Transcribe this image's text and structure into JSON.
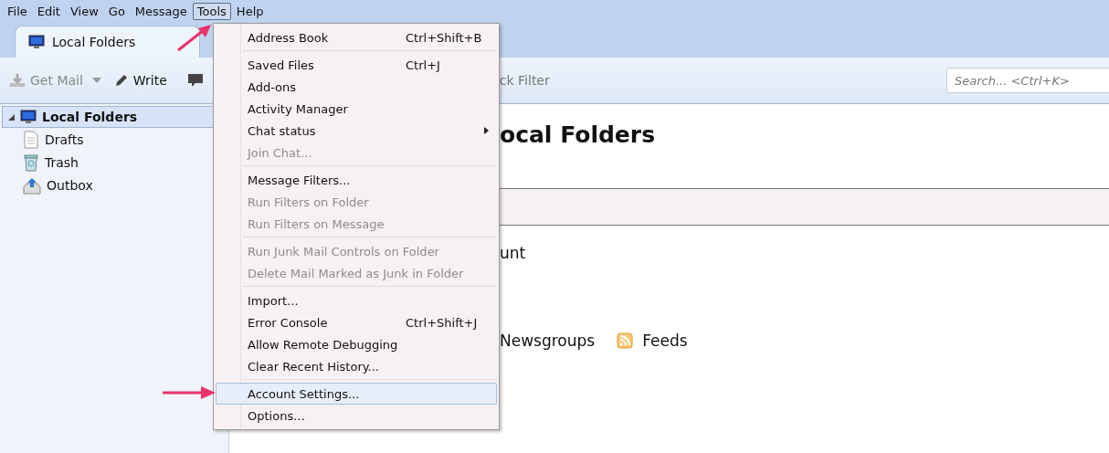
{
  "menubar": [
    {
      "label": "File",
      "selected": false
    },
    {
      "label": "Edit",
      "selected": false
    },
    {
      "label": "View",
      "selected": false
    },
    {
      "label": "Go",
      "selected": false
    },
    {
      "label": "Message",
      "selected": false
    },
    {
      "label": "Tools",
      "selected": true
    },
    {
      "label": "Help",
      "selected": false
    }
  ],
  "tabs": [
    {
      "label": "Local Folders",
      "selected": true
    }
  ],
  "toolbar": {
    "get_mail": {
      "label": "Get Mail",
      "disabled": true
    },
    "write": {
      "label": "Write"
    },
    "quick_filter_visible": "ck Filter",
    "search": {
      "placeholder": "Search... <Ctrl+K>"
    }
  },
  "sidebar": {
    "items": [
      {
        "label": "Local Folders",
        "kind": "account",
        "selected": true,
        "expanded": true,
        "children": [
          {
            "label": "Drafts",
            "kind": "drafts",
            "selected": false
          },
          {
            "label": "Trash",
            "kind": "trash",
            "selected": false
          },
          {
            "label": "Outbox",
            "kind": "outbox",
            "selected": false
          }
        ]
      }
    ]
  },
  "content": {
    "heading_visible": "ocal Folders",
    "account_text_visible": "unt",
    "newsgroups_visible": "Newsgroups",
    "feeds": "Feeds"
  },
  "tools_menu": {
    "groups": [
      [
        {
          "label": "Address Book",
          "shortcut": "Ctrl+Shift+B",
          "disabled": false,
          "selected": false,
          "submenu": false
        }
      ],
      [
        {
          "label": "Saved Files",
          "shortcut": "Ctrl+J",
          "disabled": false,
          "selected": false,
          "submenu": false
        },
        {
          "label": "Add-ons",
          "disabled": false,
          "selected": false,
          "submenu": false
        },
        {
          "label": "Activity Manager",
          "disabled": false,
          "selected": false,
          "submenu": false
        },
        {
          "label": "Chat status",
          "disabled": false,
          "selected": false,
          "submenu": true
        },
        {
          "label": "Join Chat...",
          "disabled": true,
          "selected": false,
          "submenu": false
        }
      ],
      [
        {
          "label": "Message Filters...",
          "disabled": false,
          "selected": false,
          "submenu": false
        },
        {
          "label": "Run Filters on Folder",
          "disabled": true,
          "selected": false,
          "submenu": false
        },
        {
          "label": "Run Filters on Message",
          "disabled": true,
          "selected": false,
          "submenu": false
        }
      ],
      [
        {
          "label": "Run Junk Mail Controls on Folder",
          "disabled": true,
          "selected": false,
          "submenu": false
        },
        {
          "label": "Delete Mail Marked as Junk in Folder",
          "disabled": true,
          "selected": false,
          "submenu": false
        }
      ],
      [
        {
          "label": "Import...",
          "disabled": false,
          "selected": false,
          "submenu": false
        },
        {
          "label": "Error Console",
          "shortcut": "Ctrl+Shift+J",
          "disabled": false,
          "selected": false,
          "submenu": false
        },
        {
          "label": "Allow Remote Debugging",
          "disabled": false,
          "selected": false,
          "submenu": false
        },
        {
          "label": "Clear Recent History...",
          "disabled": false,
          "selected": false,
          "submenu": false
        }
      ],
      [
        {
          "label": "Account Settings...",
          "disabled": false,
          "selected": true,
          "submenu": false
        },
        {
          "label": "Options...",
          "disabled": false,
          "selected": false,
          "submenu": false
        }
      ]
    ]
  }
}
